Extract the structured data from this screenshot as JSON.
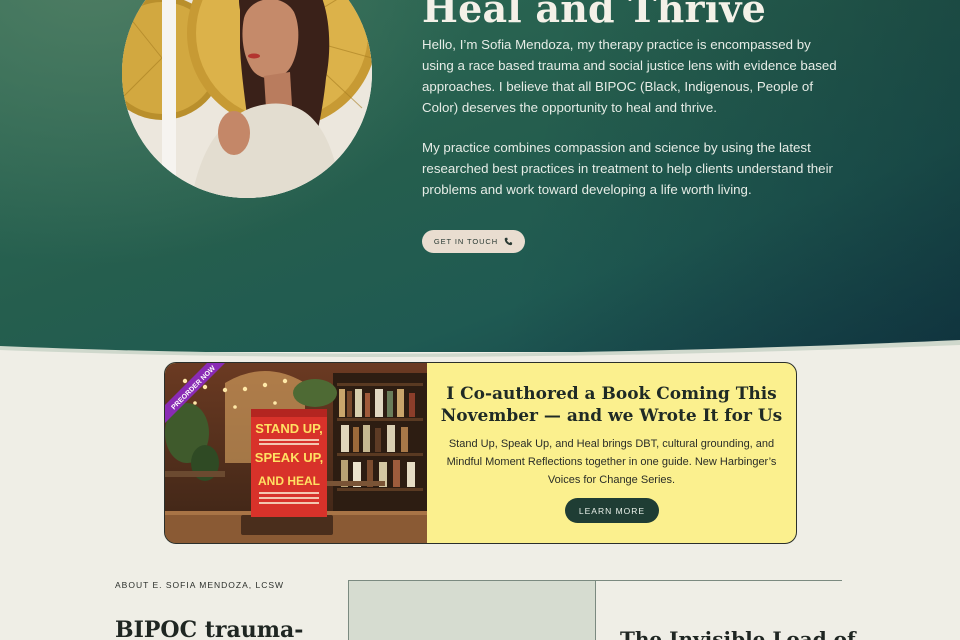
{
  "hero": {
    "title": "Heal and Thrive",
    "paragraph1": "Hello, I’m Sofia Mendoza, my therapy practice is encompassed by using a race based trauma and social justice lens with evidence based approaches. I believe that all BIPOC (Black, Indigenous, People of Color) deserves the opportunity to heal and thrive.",
    "paragraph2": "My practice combines compassion and science by using the latest researched best practices in treatment to help clients understand their problems and work toward developing a life worth living.",
    "cta_label": "GET IN TOUCH",
    "cta_icon": "phone-icon",
    "colors": {
      "hero_green": "#255e4e",
      "hero_teal": "#143f4a",
      "cta_bg": "#e9ddd0"
    }
  },
  "book": {
    "ribbon": "PREORDER NOW",
    "cover_title_lines": [
      "STAND UP,",
      "SPEAK UP,",
      "AND HEAL"
    ],
    "heading": "I Co-authored a Book Coming This November — and we Wrote It for Us",
    "description": "Stand Up, Speak Up, and Heal brings DBT, cultural grounding, and Mindful Moment Reflections together in one guide. New Harbinger’s Voices for Change Series.",
    "button_label": "LEARN MORE",
    "colors": {
      "card_bg": "#fbf08e",
      "button_bg": "#1f3d34",
      "ribbon": "#8a2bb5",
      "cover_red": "#d8322a"
    }
  },
  "about": {
    "label": "ABOUT E. SOFIA MENDOZA, LCSW",
    "heading": "BIPOC trauma-",
    "panel_title": "The Invisible Load of"
  }
}
